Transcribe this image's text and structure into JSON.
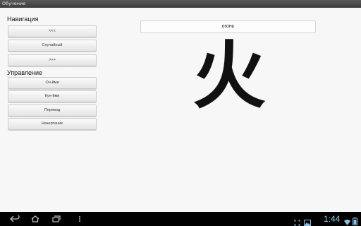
{
  "app": {
    "title": "Обучение"
  },
  "navigation": {
    "header": "Навигация",
    "buttons": [
      {
        "label": "<<<"
      },
      {
        "label": "Случайный"
      },
      {
        "label": ">>>"
      }
    ]
  },
  "control": {
    "header": "Управление",
    "buttons": [
      {
        "label": "Он-йми"
      },
      {
        "label": "Кун-йми"
      },
      {
        "label": "Перевод"
      },
      {
        "label": "Начертание"
      }
    ]
  },
  "card": {
    "meaning": "огонь",
    "kanji": "火"
  },
  "system_bar": {
    "time": "1:44",
    "icons": [
      "back-icon",
      "home-icon",
      "recent-apps-icon",
      "menu-icon",
      "screenshot-icon",
      "photo-icon",
      "wifi-icon",
      "battery-icon"
    ]
  }
}
